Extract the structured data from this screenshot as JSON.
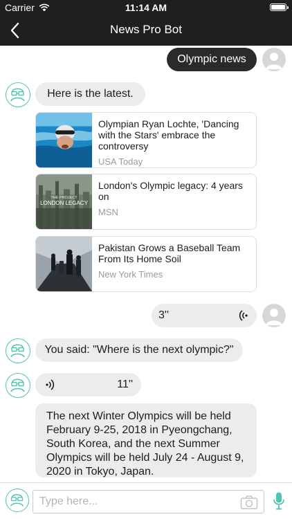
{
  "status_bar": {
    "carrier": "Carrier",
    "time": "11:14 AM",
    "battery_level": 1.0
  },
  "nav": {
    "title": "News Pro Bot",
    "back_icon": "chevron-left-icon"
  },
  "colors": {
    "accent": "#4fc4b0",
    "dark_bubble": "#2a2a2c",
    "light_bubble": "#ececef",
    "nav_bg": "#1f1f1f"
  },
  "messages": {
    "user_query": "Olympic news",
    "bot_intro": "Here is the latest.",
    "news": [
      {
        "title": "Olympian Ryan Lochte, 'Dancing with the Stars' embrace the controversy",
        "source": "USA Today"
      },
      {
        "title": "London's Olympic legacy: 4 years on",
        "source": "MSN",
        "thumb_text_1": "THE PROJECT",
        "thumb_text_2": "LONDON LEGACY"
      },
      {
        "title": "Pakistan Grows a Baseball Team From Its Home Soil",
        "source": "New York Times"
      }
    ],
    "user_voice_duration": "3''",
    "bot_you_said": "You said: \"Where is the next olympic?\"",
    "bot_voice_duration": "11''",
    "bot_answer": "The next Winter Olympics will be held February 9-25, 2018 in Pyeongchang, South Korea, and the next Summer Olympics will be held July 24 - August 9, 2020 in Tokyo, Japan."
  },
  "input": {
    "placeholder": "Type here..."
  }
}
